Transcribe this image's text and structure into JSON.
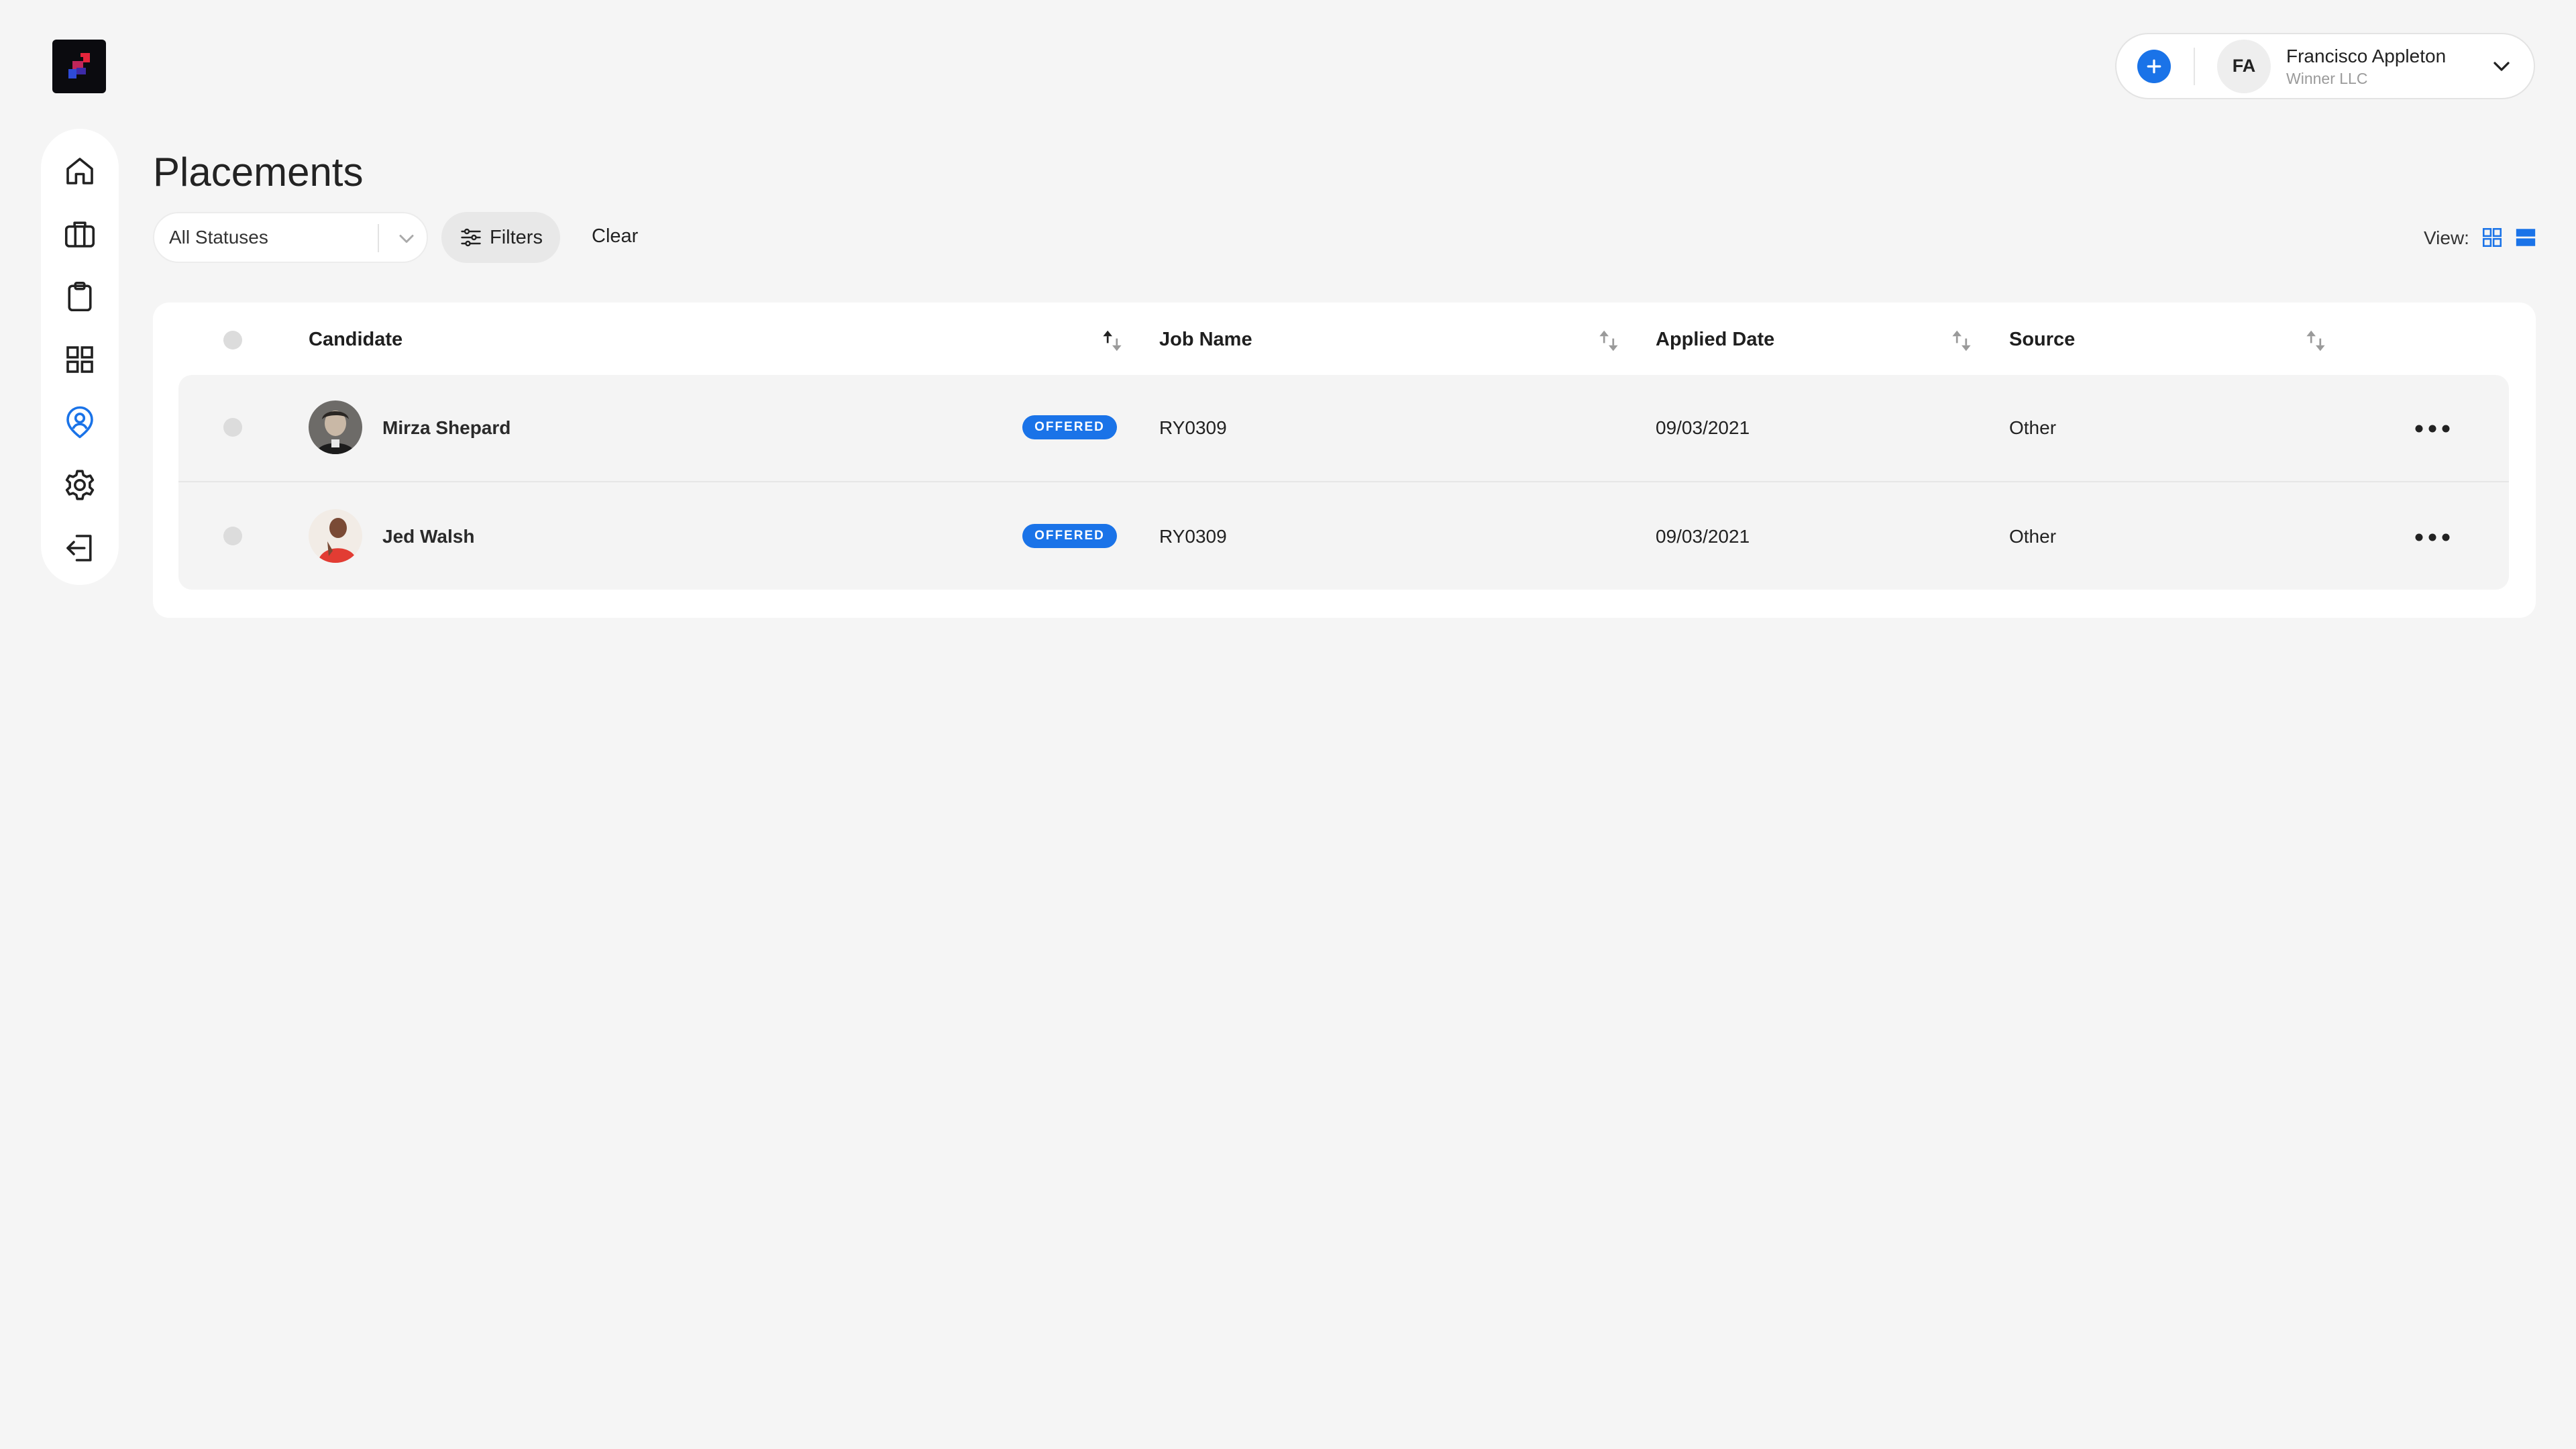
{
  "header": {
    "user_initials": "FA",
    "user_name": "Francisco Appleton",
    "user_company": "Winner LLC"
  },
  "sidebar": {
    "items": [
      {
        "name": "home",
        "icon": "home-icon",
        "active": false
      },
      {
        "name": "jobs",
        "icon": "briefcase-icon",
        "active": false
      },
      {
        "name": "clipboard",
        "icon": "clipboard-icon",
        "active": false
      },
      {
        "name": "dashboard",
        "icon": "grid-icon",
        "active": false
      },
      {
        "name": "placements",
        "icon": "user-pin-icon",
        "active": true
      },
      {
        "name": "settings",
        "icon": "gear-icon",
        "active": false
      },
      {
        "name": "logout",
        "icon": "logout-icon",
        "active": false
      }
    ]
  },
  "page": {
    "title": "Placements"
  },
  "filters": {
    "status_value": "All Statuses",
    "filters_label": "Filters",
    "clear_label": "Clear",
    "view_label": "View:"
  },
  "table": {
    "columns": {
      "candidate": "Candidate",
      "job_name": "Job Name",
      "applied_date": "Applied Date",
      "source": "Source"
    },
    "rows": [
      {
        "candidate": "Mirza Shepard",
        "status": "OFFERED",
        "job_name": "RY0309",
        "applied_date": "09/03/2021",
        "source": "Other"
      },
      {
        "candidate": "Jed Walsh",
        "status": "OFFERED",
        "job_name": "RY0309",
        "applied_date": "09/03/2021",
        "source": "Other"
      }
    ]
  },
  "colors": {
    "accent": "#1a73e8",
    "background": "#f5f5f5",
    "card": "#ffffff"
  }
}
